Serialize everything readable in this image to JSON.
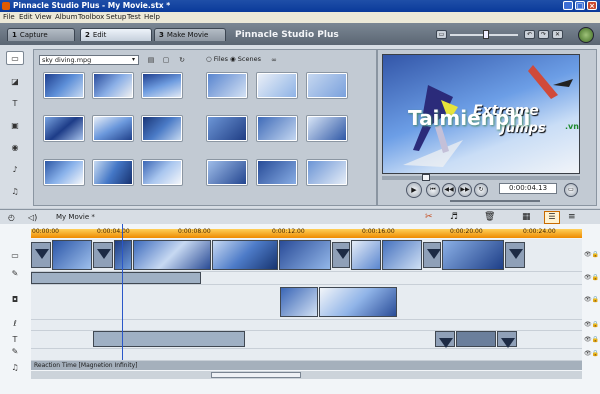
{
  "window": {
    "title": "Pinnacle Studio Plus - My Movie.stx *",
    "min": "_",
    "max": "□",
    "close": "×"
  },
  "menu": [
    "File",
    "Edit",
    "View",
    "Album",
    "Toolbox",
    "Setup",
    "Test",
    "Help"
  ],
  "tabs": [
    {
      "num": "1",
      "label": "Capture"
    },
    {
      "num": "2",
      "label": "Edit"
    },
    {
      "num": "3",
      "label": "Make Movie"
    }
  ],
  "studio_title": "Pinnacle Studio Plus",
  "album": {
    "source": "sky diving.mpg",
    "radio_files": "Files",
    "radio_scenes": "Scenes"
  },
  "monitor": {
    "title_line1": "Extreme",
    "title_line2": "Jumps",
    "timecode": "0:00:04.13"
  },
  "timeline": {
    "project": "My Movie *",
    "ruler_labels": [
      "00:00:00",
      "0:00:04.00",
      "0:00:08.00",
      "0:00:12.00",
      "0:00:16.00",
      "0:00:20.00",
      "0:00:24.00"
    ],
    "status": "Reaction Time [Magnetion Infinity]"
  },
  "watermark": {
    "text": "Taimienphi",
    "suffix": ".vn"
  }
}
